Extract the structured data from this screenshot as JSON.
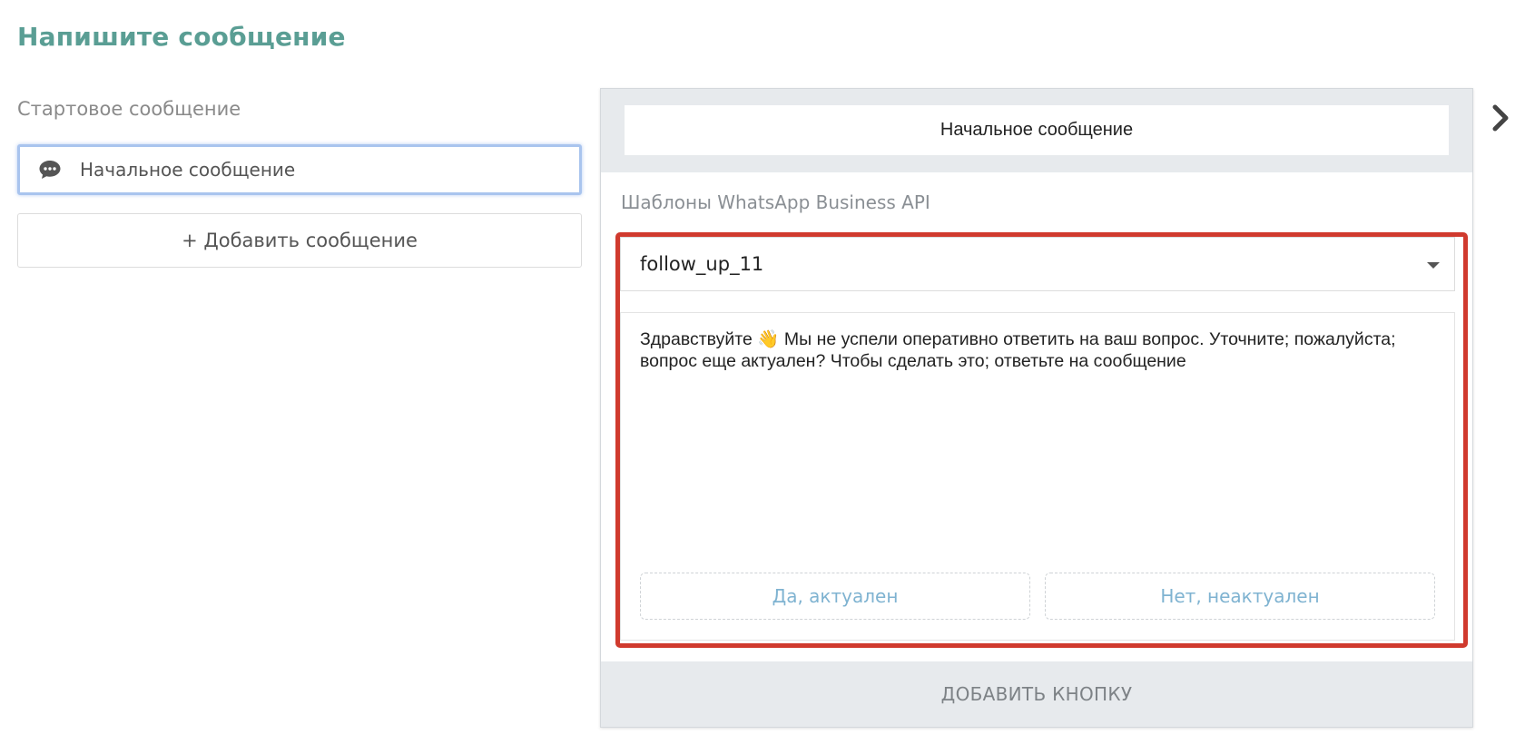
{
  "page_title": "Напишите сообщение",
  "left": {
    "section_label": "Стартовое сообщение",
    "messages": [
      {
        "label": "Начальное сообщение",
        "icon": "chat-bubble-icon"
      }
    ],
    "add_message_label": "+ Добавить сообщение"
  },
  "panel": {
    "title": "Начальное сообщение",
    "templates_label": "Шаблоны WhatsApp Business API",
    "selected_template": "follow_up_11",
    "message_text": "Здравствуйте 👋 Мы не успели оперативно ответить на ваш вопрос. Уточните; пожалуйста; вопрос еще актуален? Чтобы сделать это; ответьте на сообщение",
    "reply_buttons": [
      "Да, актуален",
      "Нет, неактуален"
    ],
    "add_button_label": "ДОБАВИТЬ КНОПКУ"
  },
  "colors": {
    "title": "#5a9e94",
    "highlight_border": "#d03a2e",
    "selected_border": "#a9c4ee",
    "reply_text": "#7fb3d1",
    "panel_gray": "#e7eaed"
  },
  "icons": {
    "message_item": "chat-bubble-icon",
    "dropdown": "caret-down-icon",
    "next": "chevron-right-icon"
  }
}
